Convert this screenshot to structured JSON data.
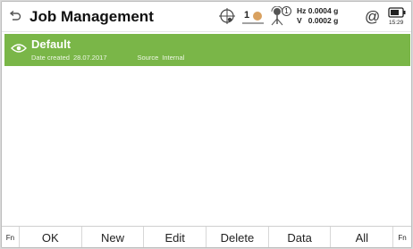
{
  "header": {
    "title": "Job Management",
    "icons": [
      "back-icon",
      "crosshair-status-icon",
      "prism-icon",
      "antenna-icon"
    ],
    "prism_value": "1",
    "antenna_value": "1",
    "hz_label": "Hz",
    "hz_value": "0.0004 g",
    "v_label": "V",
    "v_value": "0.0002 g",
    "at_symbol": "@",
    "battery_time": "15:29"
  },
  "jobs": [
    {
      "name": "Default",
      "date_label": "Date created",
      "date_value": "28.07.2017",
      "source_label": "Source",
      "source_value": "Internal",
      "selected": true
    }
  ],
  "footer": {
    "fn_left": "Fn",
    "ok": "OK",
    "new": "New",
    "edit": "Edit",
    "delete": "Delete",
    "data": "Data",
    "all": "All",
    "fn_right": "Fn"
  },
  "colors": {
    "selection": "#7ab648",
    "header_bg": "#ffffff",
    "prism_dot": "#d9a160"
  }
}
